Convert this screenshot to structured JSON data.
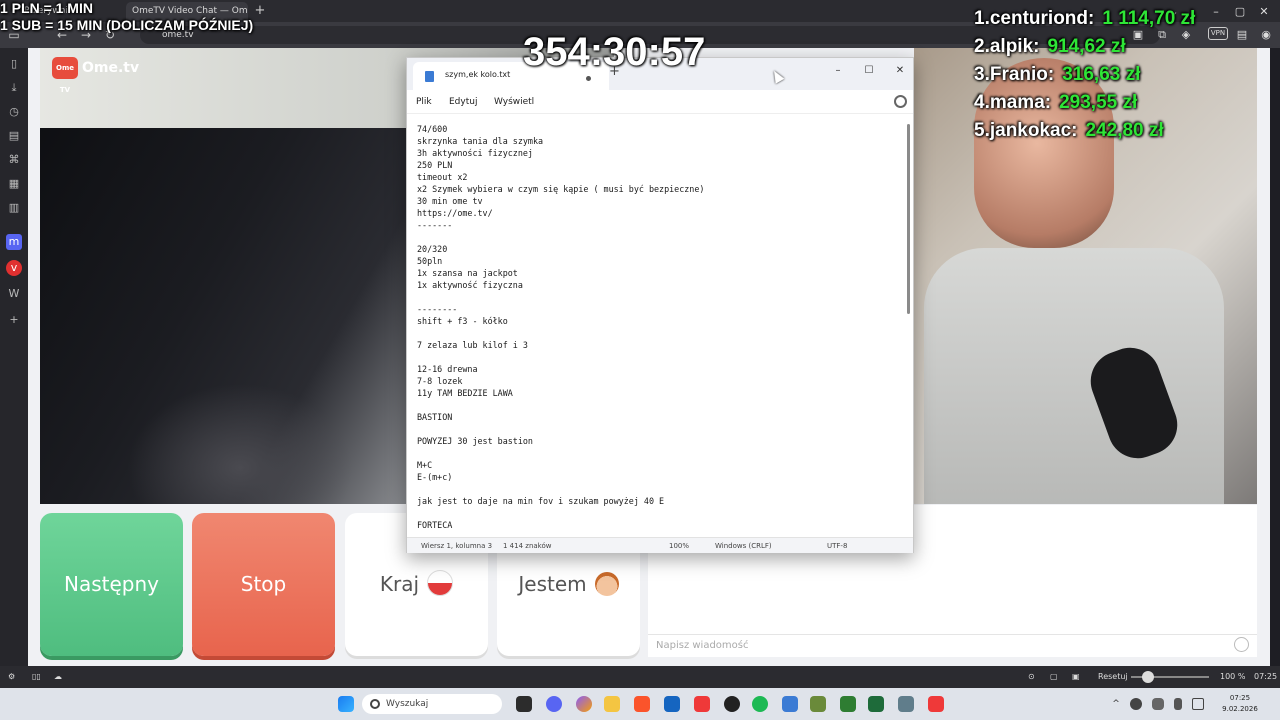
{
  "browser": {
    "tabs": [
      {
        "label": "Przerywnik",
        "active": false
      },
      {
        "label": "OmeTV Video Chat — Ome",
        "active": true
      }
    ],
    "address": "ome.tv",
    "vpn_label": "VPN"
  },
  "overlay": {
    "info_line1": "1 PLN = 1 MIN",
    "info_line2": "1 SUB = 15 MIN (DOLICZAM PÓŹNIEJ)",
    "timer": "354:30:57",
    "leaderboard": [
      {
        "name": "1.centuriond:",
        "amount": "1 114,70 zł"
      },
      {
        "name": "2.alpik:",
        "amount": "914,62 zł"
      },
      {
        "name": "3.Franio:",
        "amount": "316,63 zł"
      },
      {
        "name": "4.mama:",
        "amount": "293,55 zł"
      },
      {
        "name": "5.jankokac:",
        "amount": "242,80 zł"
      }
    ],
    "amount_color": "#2ee536"
  },
  "ometv": {
    "logo_badge": "Ome TV",
    "logo": "Ome.tv",
    "buttons": {
      "next": "Następny",
      "stop": "Stop",
      "country": "Kraj",
      "gender": "Jestem"
    },
    "chat_placeholder": "Napisz wiadomość",
    "colors": {
      "next": "#4fbd7f",
      "stop": "#e8644d"
    }
  },
  "notepad": {
    "tab_title": "szym,ek kolo.txt",
    "menu": [
      "Plik",
      "Edytuj",
      "Wyświetl"
    ],
    "lines": [
      "74/600",
      "skrzynka tania dla szymka",
      "3h aktywności fizycznej",
      "250 PLN",
      "timeout x2",
      "x2 Szymek wybiera w czym się kąpie ( musi być bezpieczne)",
      "30 min ome tv",
      "https://ome.tv/",
      "-------",
      "",
      "20/320",
      "50pln",
      "1x szansa na jackpot",
      "1x aktywność fizyczna",
      "",
      "--------",
      "shift + f3 - kółko",
      "",
      "7 zelaza lub kilof i 3",
      "",
      "12-16 drewna",
      "7-8 lozek",
      "11y TAM BEDZIE LAWA",
      "",
      "BASTION",
      "",
      "POWYZEJ 30 jest bastion",
      "",
      "M+C",
      "E-(m+c)",
      "",
      "jak jest to daje na min fov i szukam powyżej 40 E",
      "",
      "FORTECA"
    ],
    "status": {
      "position": "Wiersz 1, kolumna 3",
      "chars": "1 414 znaków",
      "zoom": "100%",
      "line_ending": "Windows (CRLF)",
      "encoding": "UTF-8"
    }
  },
  "statusbar": {
    "reset": "Resetuj",
    "zoom": "100 %",
    "time": "07:25"
  },
  "taskbar": {
    "search": "Wyszukaj",
    "time": "07:25",
    "date": "9.02.2026"
  }
}
